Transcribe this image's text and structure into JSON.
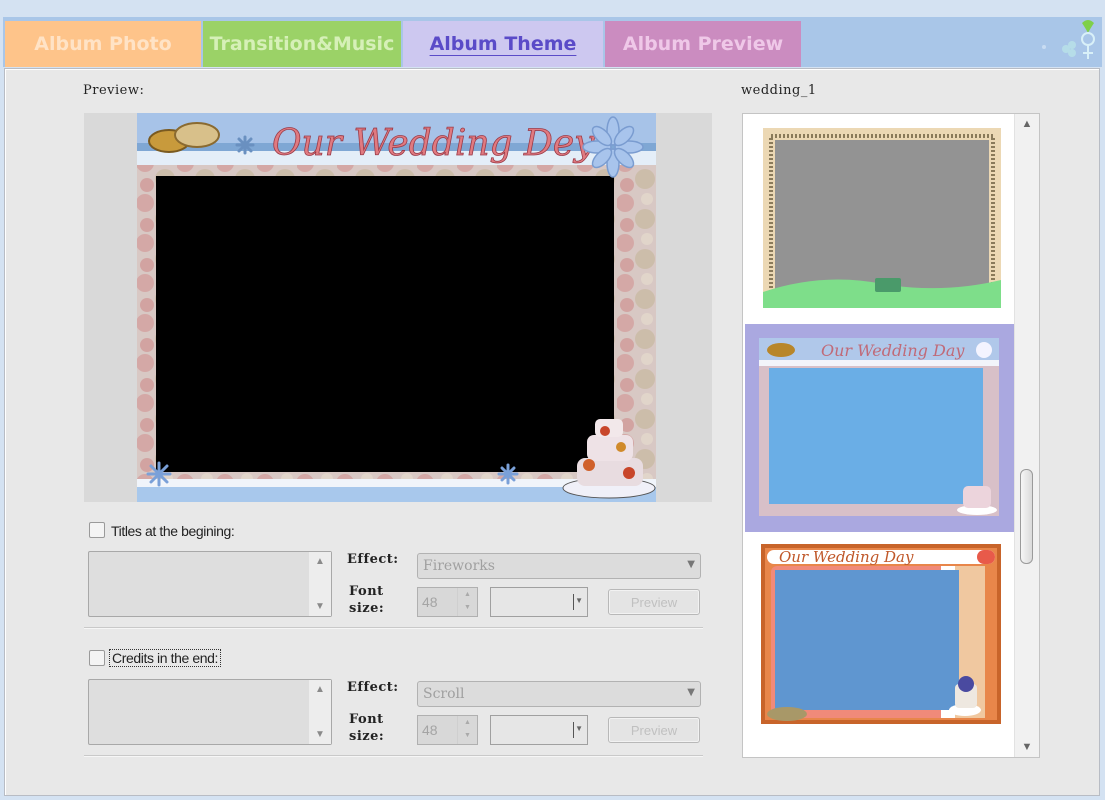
{
  "tabs": [
    {
      "label": "Album Photo",
      "active": false,
      "color": "#fec48a"
    },
    {
      "label": "Transition&Music",
      "active": false,
      "color": "#9bd267"
    },
    {
      "label": "Album Theme",
      "active": true,
      "color": "#cdc8f0"
    },
    {
      "label": "Album Preview",
      "active": false,
      "color": "#cb8cc0"
    }
  ],
  "preview": {
    "label": "Preview:",
    "frame_title": "Our Wedding Dey"
  },
  "titles": {
    "checkbox_label": "Titles at the begining:",
    "checked": false,
    "text": "",
    "effect_label": "Effect:",
    "effect_value": "Fireworks",
    "font_label_1": "Font",
    "font_label_2": "size:",
    "font_size": "48",
    "font_name": "",
    "preview_button": "Preview"
  },
  "credits": {
    "checkbox_label": "Credits in the end:",
    "checked": false,
    "text": "",
    "effect_label": "Effect:",
    "effect_value": "Scroll",
    "font_label_1": "Font",
    "font_label_2": "size:",
    "font_size": "48",
    "font_name": "",
    "preview_button": "Preview"
  },
  "theme_list": {
    "label": "wedding_1",
    "items": [
      {
        "name": "theme-gold-border",
        "selected": false
      },
      {
        "name": "theme-our-wedding-day-blue",
        "selected": true,
        "title": "Our Wedding Day"
      },
      {
        "name": "theme-our-wedding-day-orange",
        "selected": false,
        "title": "Our Wedding Day"
      }
    ],
    "selection_color": "#aaa8e0"
  }
}
